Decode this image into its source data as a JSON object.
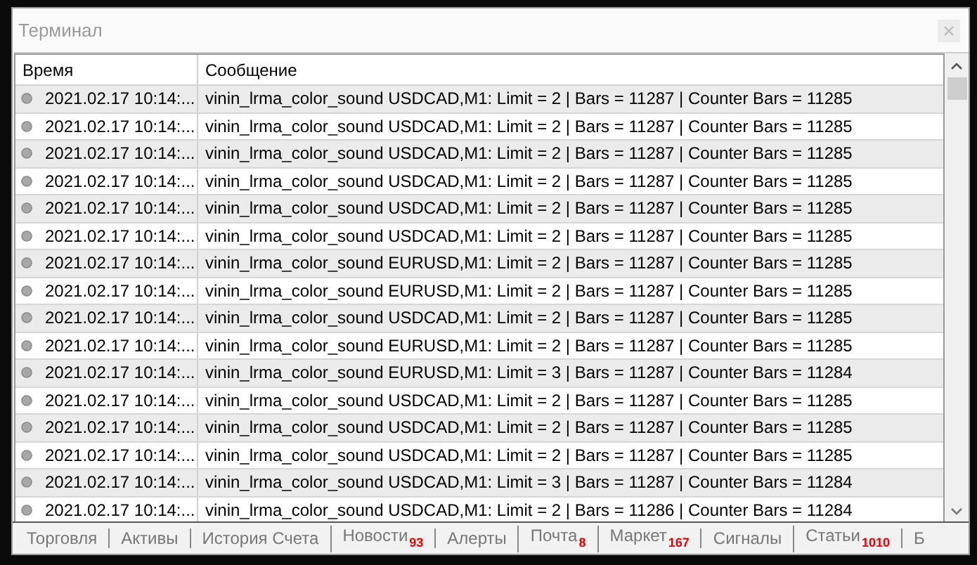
{
  "window": {
    "title": "Терминал"
  },
  "table": {
    "columns": [
      "Время",
      "Сообщение"
    ],
    "rows": [
      {
        "time": "2021.02.17 10:14:...",
        "message": "vinin_lrma_color_sound USDCAD,M1: Limit = 2 | Bars = 11287 | Counter Bars = 11285"
      },
      {
        "time": "2021.02.17 10:14:...",
        "message": "vinin_lrma_color_sound USDCAD,M1: Limit = 2 | Bars = 11287 | Counter Bars = 11285"
      },
      {
        "time": "2021.02.17 10:14:...",
        "message": "vinin_lrma_color_sound USDCAD,M1: Limit = 2 | Bars = 11287 | Counter Bars = 11285"
      },
      {
        "time": "2021.02.17 10:14:...",
        "message": "vinin_lrma_color_sound USDCAD,M1: Limit = 2 | Bars = 11287 | Counter Bars = 11285"
      },
      {
        "time": "2021.02.17 10:14:...",
        "message": "vinin_lrma_color_sound USDCAD,M1: Limit = 2 | Bars = 11287 | Counter Bars = 11285"
      },
      {
        "time": "2021.02.17 10:14:...",
        "message": "vinin_lrma_color_sound USDCAD,M1: Limit = 2 | Bars = 11287 | Counter Bars = 11285"
      },
      {
        "time": "2021.02.17 10:14:...",
        "message": "vinin_lrma_color_sound EURUSD,M1: Limit = 2 | Bars = 11287 | Counter Bars = 11285"
      },
      {
        "time": "2021.02.17 10:14:...",
        "message": "vinin_lrma_color_sound EURUSD,M1: Limit = 2 | Bars = 11287 | Counter Bars = 11285"
      },
      {
        "time": "2021.02.17 10:14:...",
        "message": "vinin_lrma_color_sound USDCAD,M1: Limit = 2 | Bars = 11287 | Counter Bars = 11285"
      },
      {
        "time": "2021.02.17 10:14:...",
        "message": "vinin_lrma_color_sound EURUSD,M1: Limit = 2 | Bars = 11287 | Counter Bars = 11285"
      },
      {
        "time": "2021.02.17 10:14:...",
        "message": "vinin_lrma_color_sound EURUSD,M1: Limit = 3 | Bars = 11287 | Counter Bars = 11284"
      },
      {
        "time": "2021.02.17 10:14:...",
        "message": "vinin_lrma_color_sound USDCAD,M1: Limit = 2 | Bars = 11287 | Counter Bars = 11285"
      },
      {
        "time": "2021.02.17 10:14:...",
        "message": "vinin_lrma_color_sound USDCAD,M1: Limit = 2 | Bars = 11287 | Counter Bars = 11285"
      },
      {
        "time": "2021.02.17 10:14:...",
        "message": "vinin_lrma_color_sound USDCAD,M1: Limit = 2 | Bars = 11287 | Counter Bars = 11285"
      },
      {
        "time": "2021.02.17 10:14:...",
        "message": "vinin_lrma_color_sound USDCAD,M1: Limit = 3 | Bars = 11287 | Counter Bars = 11284"
      },
      {
        "time": "2021.02.17 10:14:...",
        "message": "vinin_lrma_color_sound USDCAD,M1: Limit = 2 | Bars = 11286 | Counter Bars = 11284"
      }
    ]
  },
  "tabs": [
    {
      "label": "Торговля"
    },
    {
      "label": "Активы"
    },
    {
      "label": "История Счета"
    },
    {
      "label": "Новости",
      "badge": "93"
    },
    {
      "label": "Алерты"
    },
    {
      "label": "Почта",
      "badge": "8"
    },
    {
      "label": "Маркет",
      "badge": "167"
    },
    {
      "label": "Сигналы"
    },
    {
      "label": "Статьи",
      "badge": "1010"
    },
    {
      "label": "Б"
    }
  ]
}
